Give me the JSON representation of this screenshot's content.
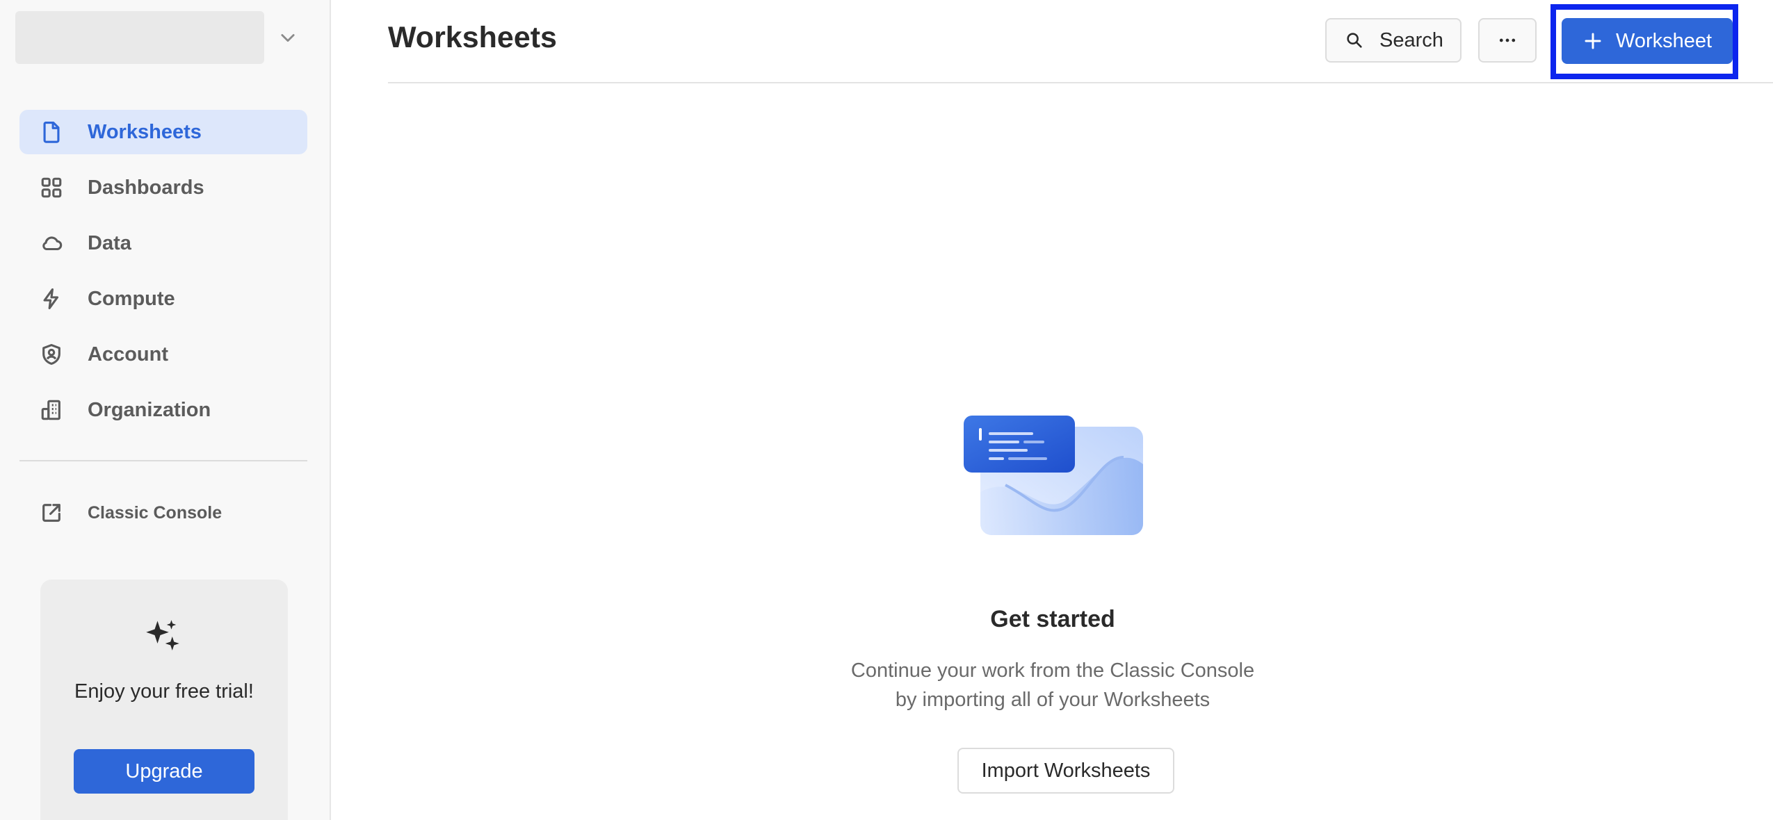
{
  "sidebar": {
    "items": [
      {
        "label": "Worksheets",
        "icon": "document-icon",
        "active": true
      },
      {
        "label": "Dashboards",
        "icon": "grid-icon",
        "active": false
      },
      {
        "label": "Data",
        "icon": "cloud-icon",
        "active": false
      },
      {
        "label": "Compute",
        "icon": "lightning-icon",
        "active": false
      },
      {
        "label": "Account",
        "icon": "shield-user-icon",
        "active": false
      },
      {
        "label": "Organization",
        "icon": "building-icon",
        "active": false
      }
    ],
    "classic_console": "Classic Console",
    "trial": {
      "text": "Enjoy your free trial!",
      "upgrade_label": "Upgrade"
    }
  },
  "header": {
    "title": "Worksheets",
    "search_label": "Search",
    "new_worksheet_label": "Worksheet"
  },
  "empty_state": {
    "title": "Get started",
    "description": "Continue your work from the Classic Console by importing all of your Worksheets",
    "import_label": "Import Worksheets"
  },
  "colors": {
    "accent": "#2e67d9",
    "active_nav_bg": "#dde7fb",
    "highlight_border": "#0c25ee"
  }
}
